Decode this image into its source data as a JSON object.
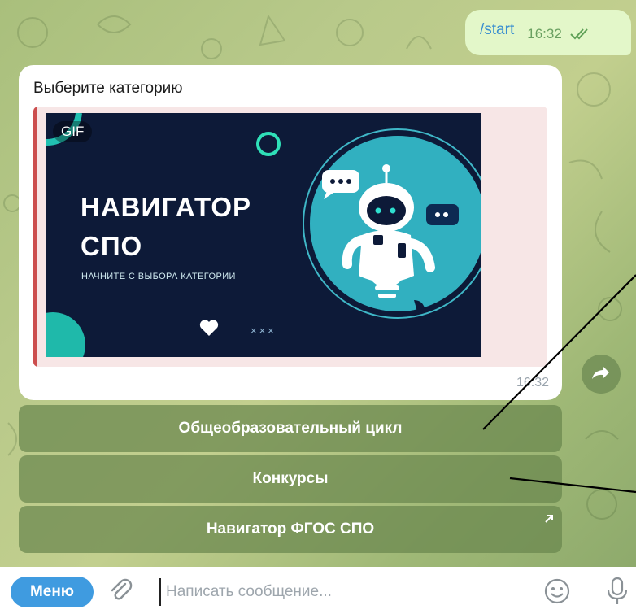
{
  "outgoing_message": {
    "text": "/start",
    "time": "16:32",
    "status_icon": "double-check-icon"
  },
  "bot_message": {
    "caption": "Выберите категорию",
    "time": "16:32",
    "gif": {
      "badge": "GIF",
      "title_line1": "НАВИГАТОР",
      "title_line2": "СПО",
      "subtitle": "НАЧНИТЕ С ВЫБОРА КАТЕГОРИИ",
      "decoration": "×××"
    }
  },
  "inline_keyboard": [
    {
      "label": "Общеобразовательный цикл"
    },
    {
      "label": "Конкурсы"
    },
    {
      "label": "Навигатор ФГОС СПО",
      "icon": "external-link-icon"
    }
  ],
  "composer": {
    "menu_label": "Меню",
    "placeholder": "Написать сообщение..."
  },
  "colors": {
    "accent": "#3f9be0",
    "outgoing_bubble": "#e3f7c9",
    "keyboard_button": "#69874e",
    "gif_background": "#0d1a38"
  }
}
